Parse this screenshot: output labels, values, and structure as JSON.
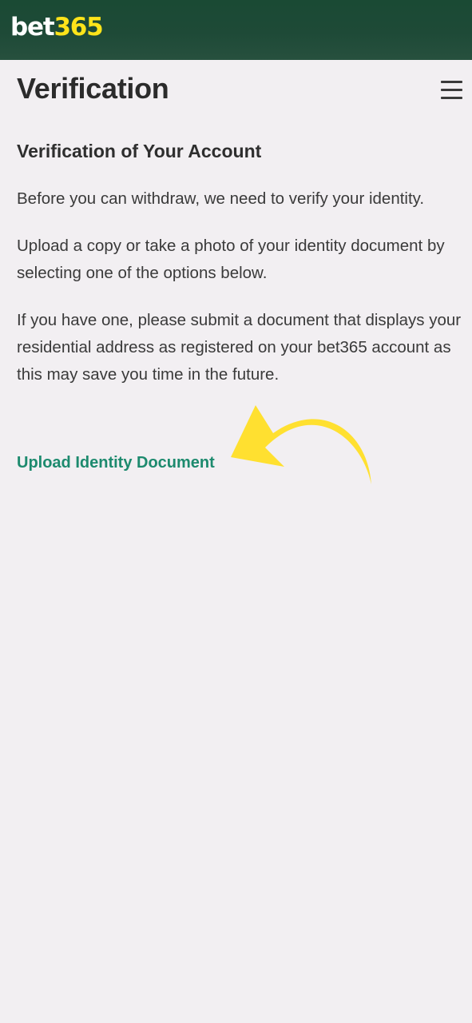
{
  "header": {
    "logo_part1": "bet",
    "logo_part2": "365",
    "brand_colors": {
      "bar": "#1e4a37",
      "logo_white": "#ffffff",
      "logo_yellow": "#ffe41a"
    }
  },
  "page": {
    "title": "Verification",
    "menu_icon": "hamburger-menu-icon"
  },
  "content": {
    "section_title": "Verification of Your Account",
    "paragraphs": [
      "Before you can withdraw, we need to verify your identity.",
      "Upload a copy or take a photo of your identity document by selecting one of the options below.",
      "If you have one, please submit a document that displays your residential address as registered on your bet365 account as this may save you time in the future."
    ],
    "upload_link": "Upload Identity Document",
    "link_color": "#1d8a6e"
  },
  "annotation": {
    "icon": "curved-arrow-icon",
    "color": "#ffe030"
  }
}
